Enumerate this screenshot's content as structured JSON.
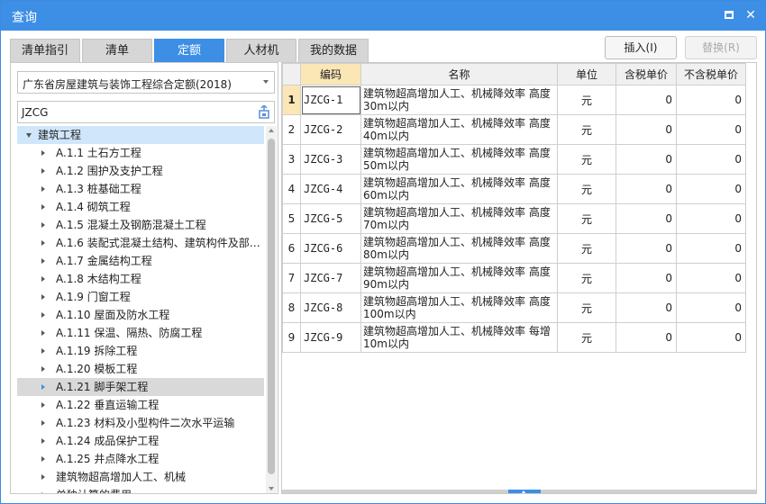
{
  "window": {
    "title": "查询",
    "maximize_icon": "maximize-icon",
    "close_icon": "close-icon",
    "close_glyph": "✕"
  },
  "tabs": [
    {
      "label": "清单指引",
      "active": false
    },
    {
      "label": "清单",
      "active": false
    },
    {
      "label": "定额",
      "active": true
    },
    {
      "label": "人材机",
      "active": false
    },
    {
      "label": "我的数据",
      "active": false
    }
  ],
  "toolbar": {
    "insert_label": "插入(I)",
    "replace_label": "替换(R)"
  },
  "left": {
    "library_select": "广东省房屋建筑与装饰工程综合定额(2018)",
    "search_value": "JZCG",
    "tree": [
      {
        "label": "建筑工程",
        "expanded": true,
        "level": 0
      },
      {
        "label": "A.1.1 土石方工程",
        "level": 1
      },
      {
        "label": "A.1.2 围护及支护工程",
        "level": 1
      },
      {
        "label": "A.1.3 桩基础工程",
        "level": 1
      },
      {
        "label": "A.1.4 砌筑工程",
        "level": 1
      },
      {
        "label": "A.1.5 混凝土及钢筋混凝土工程",
        "level": 1
      },
      {
        "label": "A.1.6 装配式混凝土结构、建筑构件及部…",
        "level": 1
      },
      {
        "label": "A.1.7 金属结构工程",
        "level": 1
      },
      {
        "label": "A.1.8 木结构工程",
        "level": 1
      },
      {
        "label": "A.1.9 门窗工程",
        "level": 1
      },
      {
        "label": "A.1.10 屋面及防水工程",
        "level": 1
      },
      {
        "label": "A.1.11 保温、隔热、防腐工程",
        "level": 1
      },
      {
        "label": "A.1.19 拆除工程",
        "level": 1
      },
      {
        "label": "A.1.20 模板工程",
        "level": 1
      },
      {
        "label": "A.1.21 脚手架工程",
        "level": 1,
        "selected": true
      },
      {
        "label": "A.1.22 垂直运输工程",
        "level": 1
      },
      {
        "label": "A.1.23 材料及小型构件二次水平运输",
        "level": 1
      },
      {
        "label": "A.1.24 成品保护工程",
        "level": 1
      },
      {
        "label": "A.1.25 井点降水工程",
        "level": 1
      },
      {
        "label": "建筑物超高增加人工、机械",
        "level": 1
      },
      {
        "label": "单独计算的费用",
        "level": 1
      }
    ]
  },
  "grid": {
    "columns": [
      "",
      "编码",
      "名称",
      "单位",
      "含税单价",
      "不含税单价"
    ],
    "rows": [
      {
        "n": "1",
        "code": "JZCG-1",
        "name": "建筑物超高增加人工、机械降效率 高度30m以内",
        "unit": "元",
        "p1": "0",
        "p2": "0"
      },
      {
        "n": "2",
        "code": "JZCG-2",
        "name": "建筑物超高增加人工、机械降效率 高度40m以内",
        "unit": "元",
        "p1": "0",
        "p2": "0"
      },
      {
        "n": "3",
        "code": "JZCG-3",
        "name": "建筑物超高增加人工、机械降效率 高度50m以内",
        "unit": "元",
        "p1": "0",
        "p2": "0"
      },
      {
        "n": "4",
        "code": "JZCG-4",
        "name": "建筑物超高增加人工、机械降效率 高度60m以内",
        "unit": "元",
        "p1": "0",
        "p2": "0"
      },
      {
        "n": "5",
        "code": "JZCG-5",
        "name": "建筑物超高增加人工、机械降效率 高度70m以内",
        "unit": "元",
        "p1": "0",
        "p2": "0"
      },
      {
        "n": "6",
        "code": "JZCG-6",
        "name": "建筑物超高增加人工、机械降效率 高度80m以内",
        "unit": "元",
        "p1": "0",
        "p2": "0"
      },
      {
        "n": "7",
        "code": "JZCG-7",
        "name": "建筑物超高增加人工、机械降效率 高度90m以内",
        "unit": "元",
        "p1": "0",
        "p2": "0"
      },
      {
        "n": "8",
        "code": "JZCG-8",
        "name": "建筑物超高增加人工、机械降效率 高度100m以内",
        "unit": "元",
        "p1": "0",
        "p2": "0"
      },
      {
        "n": "9",
        "code": "JZCG-9",
        "name": "建筑物超高增加人工、机械降效率 每增10m以内",
        "unit": "元",
        "p1": "0",
        "p2": "0"
      }
    ]
  },
  "colors": {
    "accent": "#3d8fe6",
    "highlight": "#fbe6b5",
    "tree_root_bg": "#cfe6fb"
  }
}
